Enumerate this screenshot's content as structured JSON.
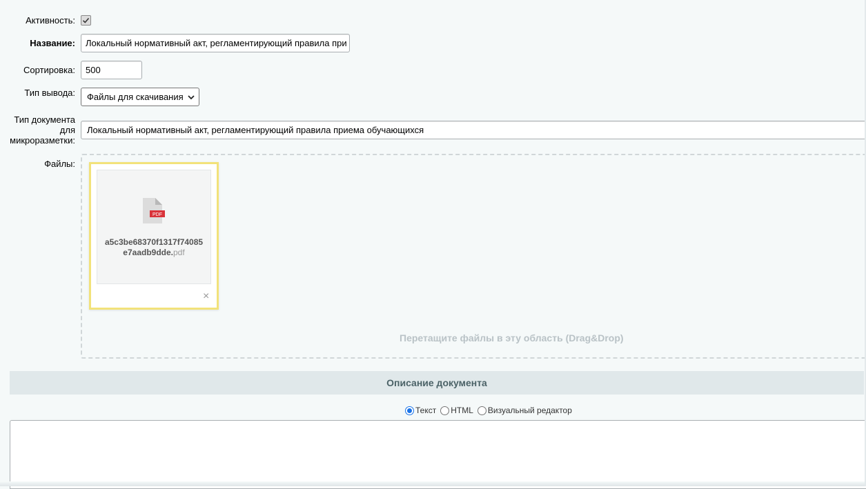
{
  "form": {
    "active_label": "Активность:",
    "active_checked": true,
    "name_label": "Название:",
    "name_value": "Локальный нормативный акт, регламентирующий правила при",
    "sort_label": "Сортировка:",
    "sort_value": "500",
    "output_type_label": "Тип вывода:",
    "output_type_value": "Файлы для скачивания",
    "doc_type_label_1": "Тип документа",
    "doc_type_label_2": "для",
    "doc_type_label_3": "микроразметки:",
    "doc_type_value": "Локальный нормативный акт, регламентирующий правила приема обучающихся",
    "files_label": "Файлы:"
  },
  "file": {
    "icon_badge": "PDF",
    "name_line1": "a5c3be68370f1317f74085",
    "name_line2": "e7aadb9dde.",
    "extension": "pdf",
    "remove_symbol": "×"
  },
  "dropzone": {
    "hint": "Перетащите файлы в эту область (Drag&Drop)"
  },
  "description": {
    "section_title": "Описание документа",
    "mode_text": "Текст",
    "mode_html": "HTML",
    "mode_visual": "Визуальный редактор",
    "selected_mode": "Текст"
  },
  "colors": {
    "background": "#f5f9f9",
    "file_card_border": "#f2e27a",
    "pdf_badge": "#d9333a",
    "section_header_bg": "#e0e8ea",
    "radio_accent": "#1a73e8"
  }
}
